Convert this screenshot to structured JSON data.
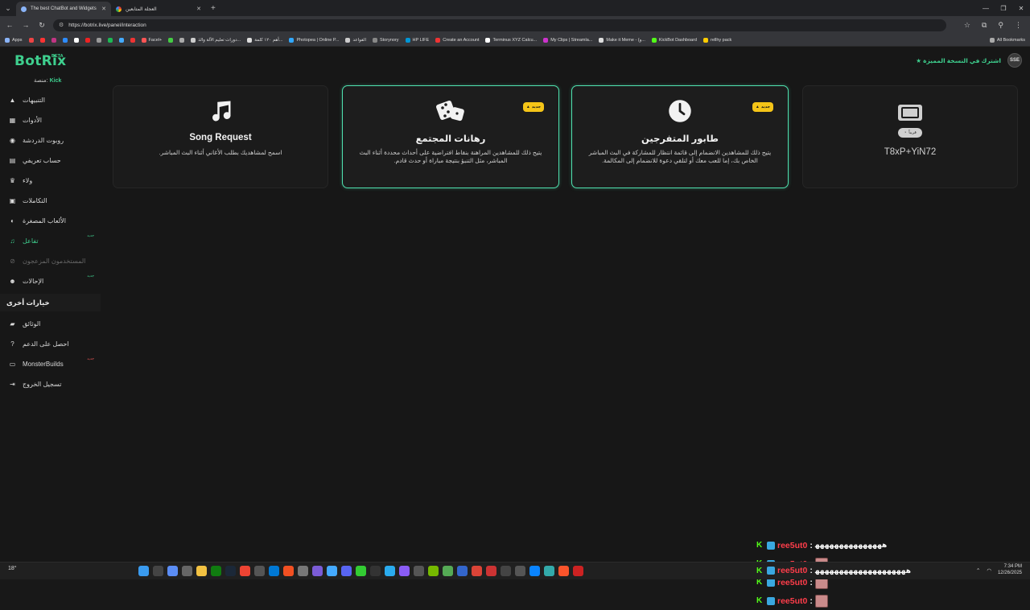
{
  "browser": {
    "tabs": [
      {
        "label": "The best ChatBot and Widgets",
        "active": true
      },
      {
        "label": "",
        "active": false
      },
      {
        "label": "العجلة المتابعين",
        "active": false
      }
    ],
    "url": "https://botrix.live/panel/interaction",
    "bookmarks": [
      "Apps",
      "Facel+",
      "دورات تعليم الآلة والذ...",
      "أهم ١٢٠ كلمة...",
      "Photopea | Online P...",
      "القواعد",
      "Storynory",
      "HP LIFE",
      "Create an Account",
      "Terminus XYZ Calcu...",
      "My Clips | Streamla...",
      "Make it Meme - (و...",
      "KickBot Dashboard",
      "rellhy pack"
    ],
    "all_bookmarks": "All Bookmarks"
  },
  "header": {
    "logo": "BotRix",
    "beta": "BETA",
    "platform_label": "منصة:",
    "platform_value": "Kick",
    "premium": "اشترك في النسخة المميزة",
    "avatar_initials": "SSE"
  },
  "sidebar": {
    "items": [
      {
        "label": "التنبيهات",
        "icon": "alert-triangle-icon"
      },
      {
        "label": "الأدوات",
        "icon": "grid-icon"
      },
      {
        "label": "روبوت الدردشة",
        "icon": "robot-icon"
      },
      {
        "label": "حساب تعريفي",
        "icon": "user-card-icon"
      },
      {
        "label": "ولاء",
        "icon": "trophy-icon"
      },
      {
        "label": "التكاملات",
        "icon": "plug-icon"
      },
      {
        "label": "الألعاب المصغرة",
        "icon": "gamepad-icon"
      },
      {
        "label": "تفاعل",
        "icon": "music-note-icon",
        "badge": "جديد"
      },
      {
        "label": "المستخدمون المزعجون",
        "icon": "ban-icon"
      },
      {
        "label": "الإحالات",
        "icon": "users-icon",
        "badge": "جديد"
      }
    ],
    "section_other": "خيارات أخرى",
    "other_items": [
      {
        "label": "الوثائق",
        "icon": "book-icon"
      },
      {
        "label": "احصل على الدعم",
        "icon": "question-circle-icon"
      },
      {
        "label": "MonsterBuilds",
        "icon": "laptop-icon",
        "badge": "جديد"
      },
      {
        "label": "تسجيل الخروج",
        "icon": "logout-icon"
      }
    ]
  },
  "cards": [
    {
      "title": "Song Request",
      "description": "اسمح لمشاهديك بطلب الأغاني أثناء البث المباشر.",
      "icon": "music-note-icon"
    },
    {
      "title": "رهانات المجتمع",
      "description": "يتيح ذلك للمشاهدين المراهنة بنقاط افتراضية على أحداث محددة أثناء البث المباشر، مثل التنبؤ بنتيجة مباراة أو حدث قادم.",
      "icon": "dice-icon",
      "tag": "جديد"
    },
    {
      "title": "طابور المتفرجين",
      "description": "يتيح ذلك للمشاهدين الانضمام إلى قائمة انتظار للمشاركة في البث المباشر الخاص بك، إما للعب معك أو لتلقي دعوة للانضمام إلى المكالمة.",
      "icon": "clock-icon",
      "tag": "جديد"
    },
    {
      "title": "T8xP+YiN72",
      "soon": "قريباً",
      "icon": "ticket-icon"
    }
  ],
  "chat": [
    {
      "user": "ree5ut0",
      "msg": "ﻫﻬﻬﻬﻬﻬﻬﻬﻬﻬﻬﻬﻬﻬﻬ"
    },
    {
      "user": "ree5ut0",
      "msg": ""
    },
    {
      "user": "ree5ut0",
      "msg": ""
    },
    {
      "user": "ree5ut0",
      "msg": ""
    },
    {
      "user": "ree5ut0",
      "msg": "ﻫﻬﻬﻬﻬﻬﻬﻬﻬﻬﻬﻬﻬﻬﻬﻬﻬﻬﻬﻬ"
    }
  ],
  "taskbar": {
    "weather": "18°",
    "time": "7:34 PM",
    "date": "12/26/2025"
  }
}
